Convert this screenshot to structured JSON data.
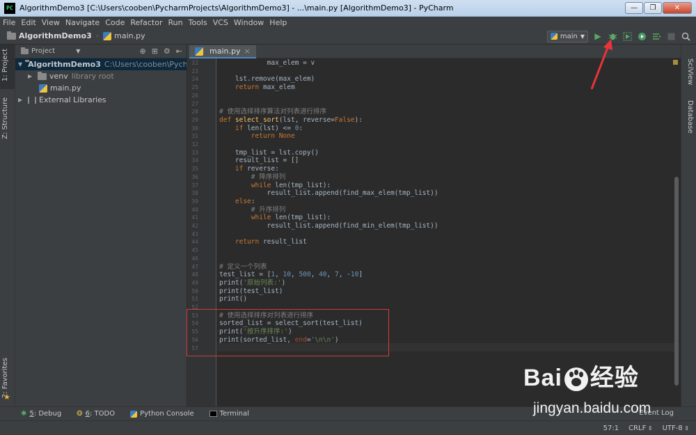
{
  "window": {
    "title": "AlgorithmDemo3 [C:\\Users\\cooben\\PycharmProjects\\AlgorithmDemo3] - ...\\main.py [AlgorithmDemo3] - PyCharm",
    "app_badge": "PC",
    "minimize": "—",
    "maximize": "❐",
    "close": "✕"
  },
  "menu": [
    "File",
    "Edit",
    "View",
    "Navigate",
    "Code",
    "Refactor",
    "Run",
    "Tools",
    "VCS",
    "Window",
    "Help"
  ],
  "navbar": {
    "project": "AlgorithmDemo3",
    "file": "main.py",
    "run_config": "main"
  },
  "left_tabs": {
    "project": "1: Project",
    "structure": "Z: Structure",
    "favorites": "2: Favorites"
  },
  "right_tabs": {
    "sciview": "SciView",
    "database": "Database"
  },
  "project_panel": {
    "header": "Project",
    "root_name": "AlgorithmDemo3",
    "root_path": "C:\\Users\\cooben\\PycharmP",
    "venv": "venv",
    "venv_note": "library root",
    "main_file": "main.py",
    "ext_libs": "External Libraries"
  },
  "editor_tab": {
    "label": "main.py",
    "close": "×"
  },
  "code_lines": [
    {
      "n": "22",
      "html": "            max_elem = v"
    },
    {
      "n": "23",
      "html": ""
    },
    {
      "n": "24",
      "html": "    lst.remove(max_elem)"
    },
    {
      "n": "25",
      "html": "    <span class='kw'>return</span> max_elem"
    },
    {
      "n": "26",
      "html": ""
    },
    {
      "n": "27",
      "html": ""
    },
    {
      "n": "28",
      "html": "<span class='cm'># 使用选择排序算法对列表进行排序</span>"
    },
    {
      "n": "29",
      "html": "<span class='kw'>def</span> <span class='fn'>select_sort</span>(lst, reverse=<span class='kw'>False</span>):"
    },
    {
      "n": "30",
      "html": "    <span class='kw'>if</span> len(lst) &lt;= <span class='num'>0</span>:"
    },
    {
      "n": "31",
      "html": "        <span class='kw'>return None</span>"
    },
    {
      "n": "32",
      "html": ""
    },
    {
      "n": "33",
      "html": "    tmp_list = lst.copy()"
    },
    {
      "n": "34",
      "html": "    result_list = []"
    },
    {
      "n": "35",
      "html": "    <span class='kw'>if</span> reverse:"
    },
    {
      "n": "36",
      "html": "        <span class='cm'># 降序排列</span>"
    },
    {
      "n": "37",
      "html": "        <span class='kw'>while</span> len(tmp_list):"
    },
    {
      "n": "38",
      "html": "            result_list.append(find_max_elem(tmp_list))"
    },
    {
      "n": "39",
      "html": "    <span class='kw'>else</span>:"
    },
    {
      "n": "40",
      "html": "        <span class='cm'># 升序排列</span>"
    },
    {
      "n": "41",
      "html": "        <span class='kw'>while</span> len(tmp_list):"
    },
    {
      "n": "42",
      "html": "            result_list.append(find_min_elem(tmp_list))"
    },
    {
      "n": "43",
      "html": ""
    },
    {
      "n": "44",
      "html": "    <span class='kw'>return</span> result_list"
    },
    {
      "n": "45",
      "html": ""
    },
    {
      "n": "46",
      "html": ""
    },
    {
      "n": "47",
      "html": "<span class='cm'># 定义一个列表</span>"
    },
    {
      "n": "48",
      "html": "test_list = [<span class='num'>1</span>, <span class='num'>10</span>, <span class='num'>500</span>, <span class='num'>40</span>, <span class='num'>7</span>, -<span class='num'>10</span>]"
    },
    {
      "n": "49",
      "html": "print(<span class='str'>'原始列表:'</span>)"
    },
    {
      "n": "50",
      "html": "print(test_list)"
    },
    {
      "n": "51",
      "html": "print()"
    },
    {
      "n": "52",
      "html": ""
    },
    {
      "n": "53",
      "html": "<span class='cm'># 使用选择排序对列表进行排序</span>"
    },
    {
      "n": "54",
      "html": "sorted_list = select_sort(test_list)"
    },
    {
      "n": "55",
      "html": "print(<span class='str'>'按升序排序:'</span>)"
    },
    {
      "n": "56",
      "html": "print(sorted_list, <span class='param'>end</span>=<span class='str'>'\\n\\n'</span>)"
    },
    {
      "n": "57",
      "html": ""
    }
  ],
  "bottom_tabs": [
    {
      "key": "5",
      "label": ": Debug"
    },
    {
      "key": "6",
      "label": ": TODO"
    },
    {
      "key": "",
      "label": "Python Console"
    },
    {
      "key": "",
      "label": "Terminal"
    }
  ],
  "event_log": "Event Log",
  "status": {
    "position": "57:1",
    "line_sep": "CRLF",
    "encoding": "UTF-8"
  },
  "watermark": {
    "brand_left": "Bai",
    "brand_right": "经验",
    "url": "jingyan.baidu.com"
  },
  "colors": {
    "arrow": "#e8343a",
    "highlight_box": "#d33b3b",
    "run_green": "#59a869"
  }
}
